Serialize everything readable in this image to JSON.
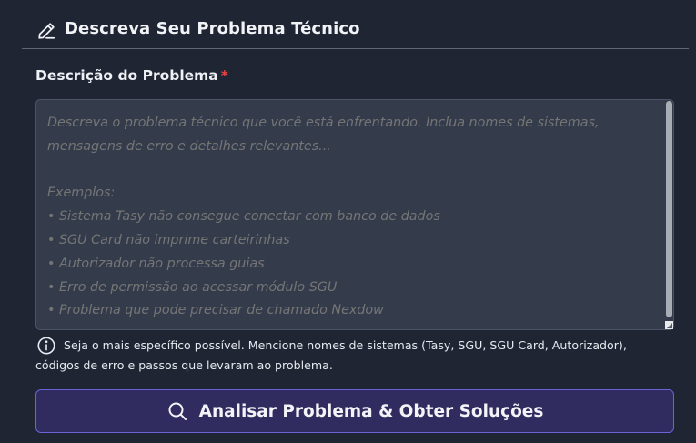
{
  "header": {
    "title": "Descreva Seu Problema Técnico",
    "icon": "pencil-icon"
  },
  "field": {
    "label": "Descrição do Problema",
    "required_mark": "*",
    "value": "",
    "placeholder": "Descreva o problema técnico que você está enfrentando. Inclua nomes de sistemas, mensagens de erro e detalhes relevantes...\n\nExemplos:\n• Sistema Tasy não consegue conectar com banco de dados\n• SGU Card não imprime carteirinhas\n• Autorizador não processa guias\n• Erro de permissão ao acessar módulo SGU\n• Problema que pode precisar de chamado Nexdow"
  },
  "hint": {
    "icon": "info-icon",
    "text": "Seja o mais específico possível. Mencione nomes de sistemas (Tasy, SGU, SGU Card, Autorizador), códigos de erro e passos que levaram ao problema."
  },
  "submit": {
    "icon": "search-icon",
    "label": "Analisar Problema & Obter Soluções"
  },
  "colors": {
    "background": "#1f2533",
    "textarea_bg": "#343c4c",
    "button_bg": "#302c5f",
    "button_border": "#6b63d8",
    "required": "#ef4444"
  }
}
